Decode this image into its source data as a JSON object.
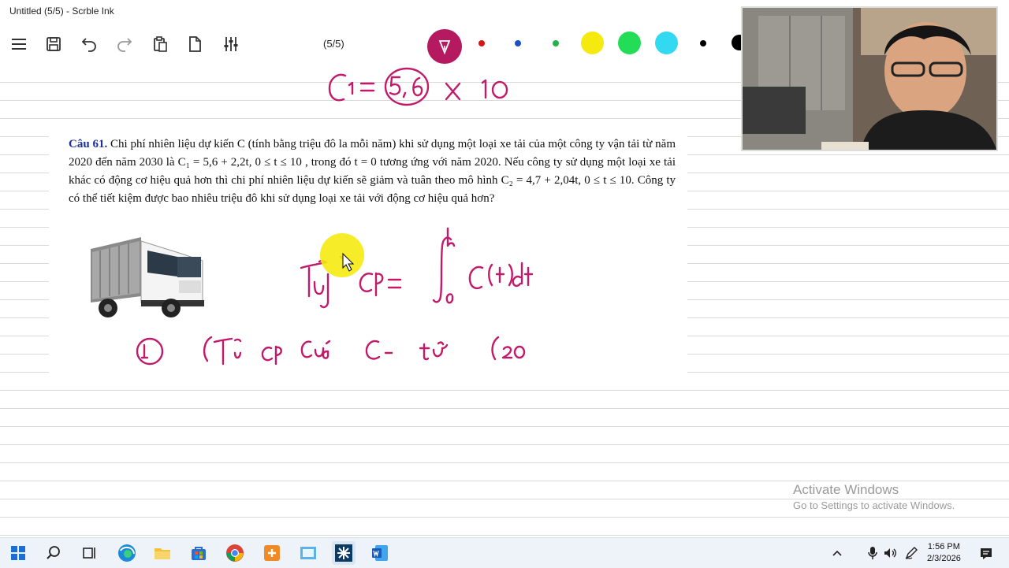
{
  "window": {
    "title": "Untitled (5/5) - Scrble Ink"
  },
  "toolbar": {
    "page_indicator": "(5/5)",
    "icons": [
      "menu-icon",
      "save-icon",
      "undo-icon",
      "redo-icon",
      "paste-icon",
      "new-page-icon",
      "settings-sliders-icon",
      "pen-icon"
    ],
    "colors": [
      "#d51414",
      "#1b4fc9",
      "#22b24b",
      "#f5ea10",
      "#22dd55",
      "#33d9f0",
      "#000000"
    ]
  },
  "question": {
    "number_label": "Câu 61.",
    "body": "Chi phí nhiên liệu dự kiến C (tính bằng triệu đô la mỗi năm) khi sử dụng một loại xe tải của một công ty vận tải từ năm 2020 đến năm 2030 là C₁ = 5,6 + 2,2t, 0 ≤ t ≤ 10 , trong đó t = 0 tương ứng với năm 2020. Nếu công ty sử dụng một loại xe tải khác có động cơ hiệu quả hơn thì chi phí nhiên liệu dự kiến sẽ giảm và tuân theo mô hình C₂ = 4,7 + 2,04t, 0 ≤ t ≤ 10. Công ty có thể tiết kiệm được bao nhiêu triệu đô khi sử dụng loại xe tải với động cơ hiệu quả hơn?"
  },
  "handwriting": {
    "line1": "C₁ = (5,6) × 10",
    "line2": "Tổng CP = ∫ₐᵇ C(t)dt",
    "line3": "① (Tổng CP của C₁ từ (20"
  },
  "watermark": {
    "line1": "Activate Windows",
    "line2": "Go to Settings to activate Windows."
  },
  "taskbar": {
    "apps": [
      "windows-start-icon",
      "search-icon",
      "task-view-icon",
      "edge-icon",
      "file-explorer-icon",
      "store-icon",
      "chrome-icon",
      "app-orange-icon",
      "app-blue-icon",
      "scrble-ink-icon",
      "word-icon"
    ],
    "tray": [
      "chevron-up-icon",
      "microphone-icon",
      "speaker-icon",
      "pen-tray-icon"
    ],
    "time": "1:56 PM",
    "date": "2/3/2026"
  }
}
